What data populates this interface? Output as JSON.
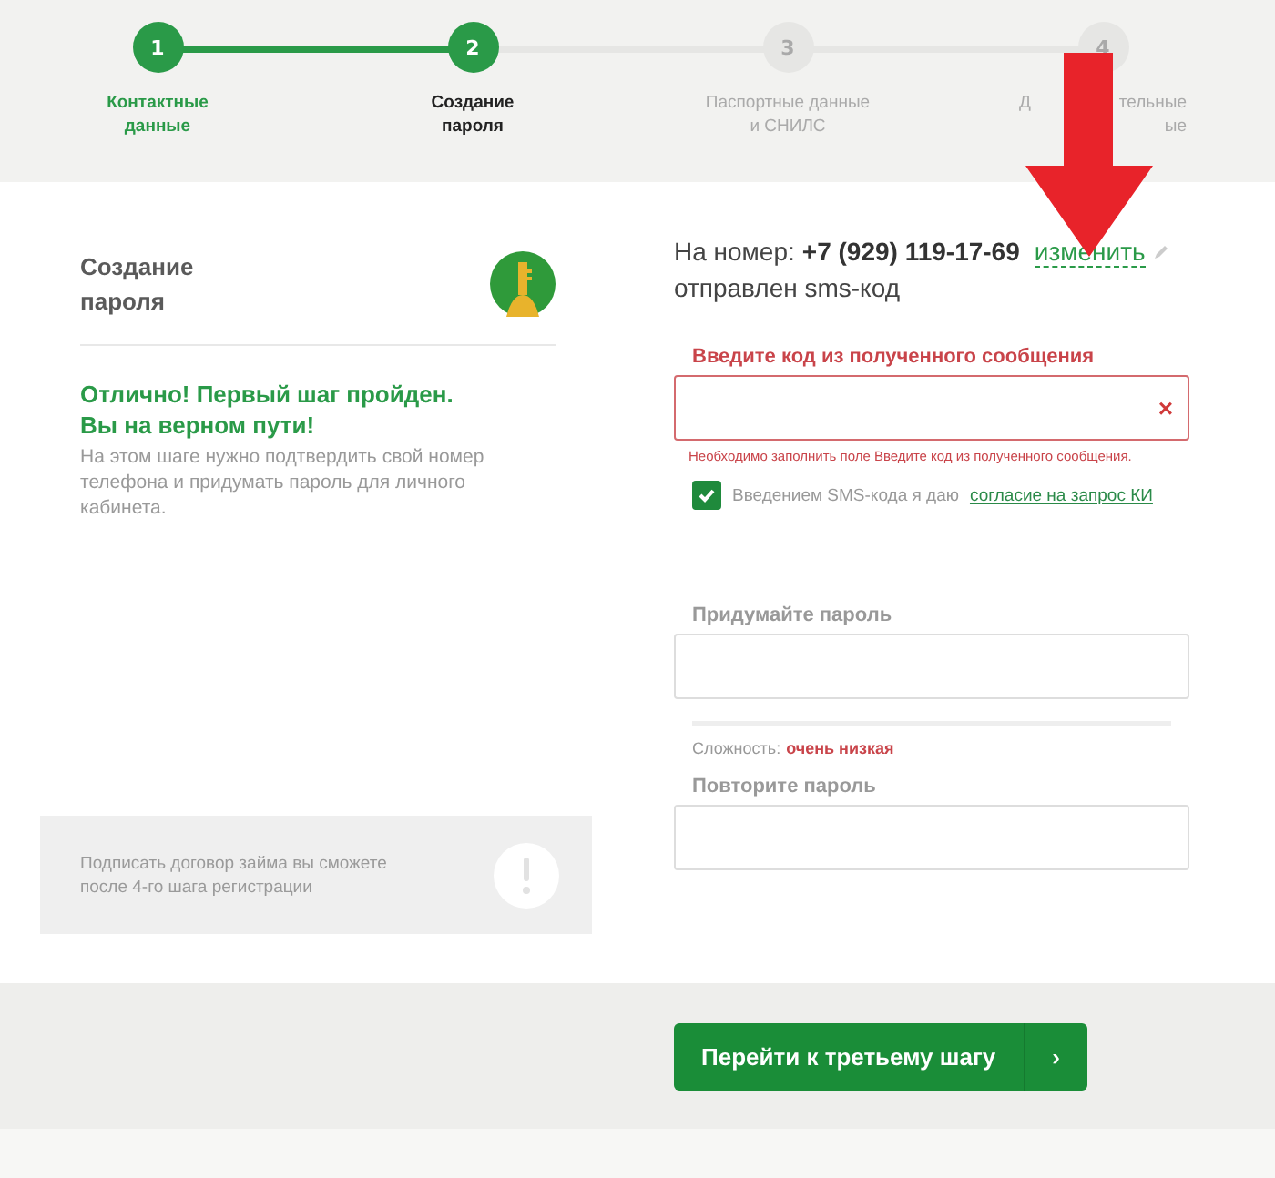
{
  "steps": [
    {
      "number": "1",
      "label": [
        [
          "Контактные"
        ],
        [
          "данные"
        ]
      ],
      "done": true,
      "selected": false
    },
    {
      "number": "2",
      "label": [
        [
          "Создание"
        ],
        [
          "пароля"
        ]
      ],
      "done": true,
      "selected": true
    },
    {
      "number": "3",
      "label": [
        [
          "Паспортные данные"
        ],
        [
          "и СНИЛС"
        ]
      ],
      "done": false,
      "selected": false
    },
    {
      "number": "4",
      "label": [
        [
          "Д",
          "тельные"
        ],
        [
          "ые"
        ]
      ],
      "done": false,
      "selected": false
    }
  ],
  "info": {
    "title": [
      "Создание",
      "пароля"
    ],
    "heading": [
      "Отлично! Первый шаг пройден.",
      "Вы на верном пути!"
    ],
    "text": "На этом шаге нужно подтвердить свой номер телефона и придумать пароль для личного кабинета.",
    "notice": [
      "Подписать договор займа вы сможете",
      "после 4-го шага регистрации"
    ]
  },
  "phone": {
    "prefix": "На номер:",
    "number": "+7 (929) 119-17-69",
    "change_link": "изменить",
    "suffix": "отправлен sms-код"
  },
  "code_field": {
    "label": "Введите код из полученного сообщения",
    "clear": "×",
    "error": "Необходимо заполнить поле Введите код из полученного сообщения."
  },
  "consent": {
    "checked": true,
    "text": "Введением SMS-кода я даю",
    "link": "согласие на запрос КИ"
  },
  "password": {
    "label": "Придумайте пароль",
    "level": 0,
    "strength_label": "Сложность:",
    "strength_value": "очень низкая"
  },
  "repeat": {
    "label": "Повторите пароль"
  },
  "submit": {
    "label": "Перейти к третьему шагу",
    "arrow": "›"
  }
}
